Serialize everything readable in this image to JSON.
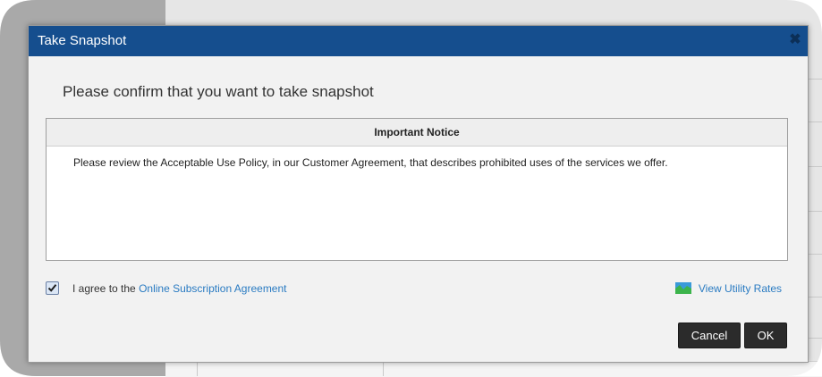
{
  "dialog": {
    "title": "Take Snapshot",
    "close_icon": "close-x-icon",
    "prompt": "Please confirm that you want to take snapshot",
    "notice": {
      "header": "Important Notice",
      "body": "Please review the Acceptable Use Policy, in our Customer Agreement, that describes prohibited uses of the services we offer."
    },
    "agreement": {
      "checked": true,
      "label_prefix": "I agree to the ",
      "link_text": "Online Subscription Agreement"
    },
    "rates_link": {
      "icon": "chart-icon",
      "text": "View Utility Rates"
    },
    "buttons": {
      "cancel": "Cancel",
      "ok": "OK"
    }
  },
  "colors": {
    "titlebar": "#154e8e",
    "link": "#2a7bc2",
    "button": "#2b2b2b"
  }
}
